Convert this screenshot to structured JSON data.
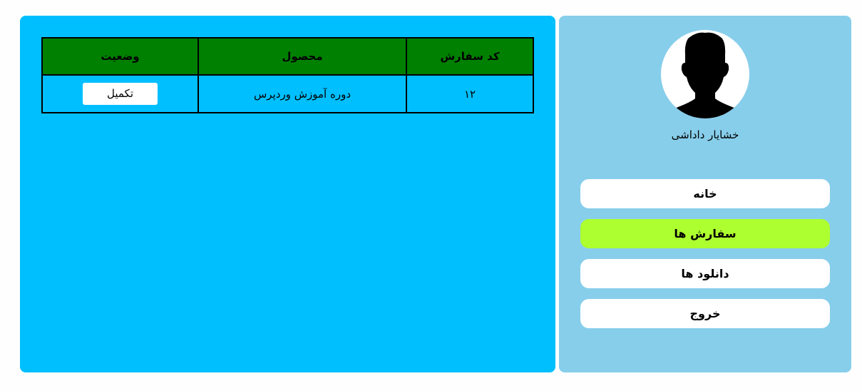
{
  "orders": {
    "headers": {
      "code": "کد سفارش",
      "product": "محصول",
      "status": "وضعیت"
    },
    "rows": [
      {
        "code": "۱۲",
        "product": "دوره آموزش وردپرس",
        "status": "تکمیل"
      }
    ]
  },
  "user": {
    "name": "خشایار داداشی",
    "avatar_icon": "user-silhouette-icon"
  },
  "nav": {
    "items": [
      {
        "label": "خانه",
        "active": false
      },
      {
        "label": "سفارش ها",
        "active": true
      },
      {
        "label": "دانلود ها",
        "active": false
      },
      {
        "label": "خروج",
        "active": false
      }
    ]
  },
  "colors": {
    "main_panel": "#00bfff",
    "sidebar": "#87ceeb",
    "table_header": "#008000",
    "active_nav": "#adff2f"
  }
}
